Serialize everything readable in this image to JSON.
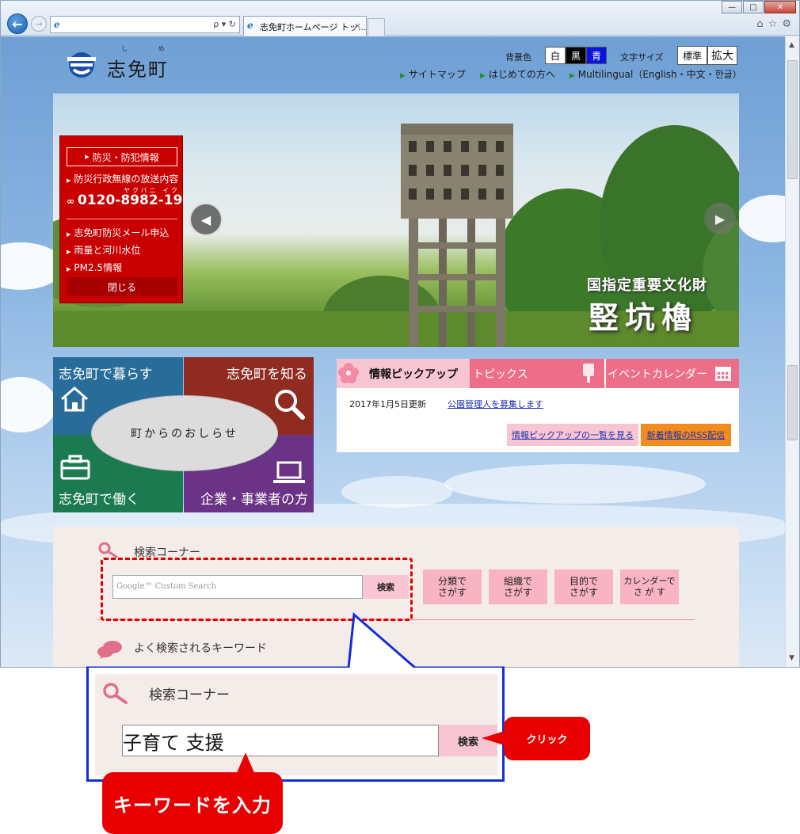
{
  "browser": {
    "window_buttons": [
      "—",
      "□",
      "✕"
    ],
    "nav_back": "←",
    "nav_forward": "→",
    "address_icon": "ie-icon",
    "address_controls": "ρ ▾ ↻",
    "tab_title": "志免町ホームページ トッ...",
    "tab_close": "×",
    "toolbar_icons": [
      "⌂",
      "☆",
      "⚙"
    ]
  },
  "header": {
    "site_name": "志免町",
    "site_name_ruby": "し め",
    "bg_color_label": "背景色",
    "bg_colors": [
      {
        "label": "白",
        "bg": "#ffffff",
        "fg": "#111111"
      },
      {
        "label": "黒",
        "bg": "#000000",
        "fg": "#ffffff"
      },
      {
        "label": "青",
        "bg": "#0a14e0",
        "fg": "#ffffff"
      }
    ],
    "font_size_label": "文字サイズ",
    "font_sizes": [
      "標準",
      "拡大"
    ],
    "links": [
      "サイトマップ",
      "はじめての方へ",
      "Multilingual（English・中文・한글）"
    ]
  },
  "hero": {
    "caption_small": "国指定重要文化財",
    "caption_large": "竪坑櫓",
    "prev": "◀",
    "next": "▶"
  },
  "disaster": {
    "head": "防災・防犯情報",
    "broadcast": "防災行政無線の放送内容",
    "tel_ruby": "ヤクバニ イク",
    "tel": "0120-8982-19",
    "items": [
      "志免町防災メール申込",
      "雨量と河川水位",
      "PM2.5情報"
    ],
    "close": "閉じる"
  },
  "quads": {
    "live": "志免町で暮らす",
    "know": "志免町を知る",
    "work": "志免町で働く",
    "business": "企業・事業者の方",
    "notice": "町からのおしらせ"
  },
  "info": {
    "tabs": [
      "情報ピックアップ",
      "トピックス",
      "イベントカレンダー"
    ],
    "date": "2017年1月5日更新",
    "link": "公園管理人を募集します",
    "list_button": "情報ピックアップの一覧を見る",
    "rss_button": "新着情報のRSS配信"
  },
  "search": {
    "title": "検索コーナー",
    "placeholder_brand": "Google™ Custom Search",
    "button": "検索",
    "categories": [
      [
        "分類で",
        "さがす"
      ],
      [
        "組織で",
        "さがす"
      ],
      [
        "目的で",
        "さがす"
      ],
      [
        "カレンダーで",
        "さ が す"
      ]
    ],
    "keywords_title": "よく検索されるキーワード"
  },
  "zoom": {
    "title": "検索コーナー",
    "input_value": "子育て  支援",
    "button": "検索"
  },
  "bubbles": {
    "click": "クリック",
    "enter_keyword": "キーワードを入力"
  },
  "colors": {
    "accent_pink": "#f8c6d2",
    "tab_pink": "#ec6e88",
    "alert_red": "#e80000",
    "callout_blue": "#1030d6"
  }
}
